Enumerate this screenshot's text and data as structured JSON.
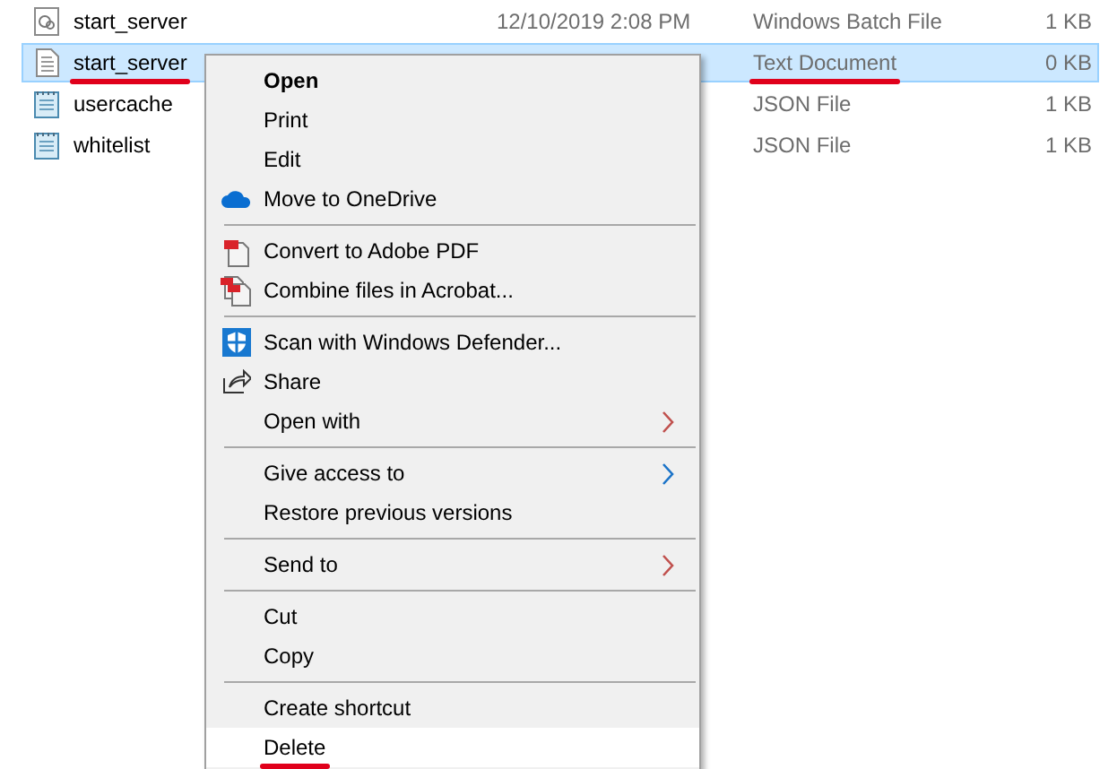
{
  "files": [
    {
      "name": "start_server",
      "date": "12/10/2019 2:08 PM",
      "type": "Windows Batch File",
      "size": "1 KB",
      "kind": "batch",
      "selected": false,
      "underlined": false
    },
    {
      "name": "start_server",
      "type": "Text Document",
      "size": "0 KB",
      "kind": "text",
      "selected": true,
      "underlined": true
    },
    {
      "name": "usercache",
      "type": "JSON File",
      "size": "1 KB",
      "kind": "json",
      "selected": false,
      "underlined": false
    },
    {
      "name": "whitelist",
      "type": "JSON File",
      "size": "1 KB",
      "kind": "json",
      "selected": false,
      "underlined": false
    }
  ],
  "context_menu": {
    "sections": [
      [
        {
          "label": "Open",
          "bold": true,
          "selected": false
        },
        {
          "label": "Print",
          "selected": false
        },
        {
          "label": "Edit",
          "selected": false
        },
        {
          "label": "Move to OneDrive",
          "selected": false
        }
      ],
      [
        {
          "label": "Convert to Adobe PDF",
          "selected": false
        },
        {
          "label": "Combine files in Acrobat...",
          "selected": false
        }
      ],
      [
        {
          "label": "Scan with Windows Defender...",
          "selected": false
        },
        {
          "label": "Share",
          "selected": false
        },
        {
          "label": "Open with",
          "submenu": true,
          "color": "#c0504d",
          "selected": false
        }
      ],
      [
        {
          "label": "Give access to",
          "submenu": true,
          "color": "#1a73c8",
          "selected": false
        },
        {
          "label": "Restore previous versions",
          "selected": false
        }
      ],
      [
        {
          "label": "Send to",
          "submenu": true,
          "color": "#c0504d",
          "selected": false
        }
      ],
      [
        {
          "label": "Cut",
          "selected": false
        },
        {
          "label": "Copy",
          "selected": false
        }
      ],
      [
        {
          "label": "Create shortcut",
          "selected": false
        },
        {
          "label": "Delete",
          "selected": true,
          "underlined": true
        }
      ]
    ]
  }
}
